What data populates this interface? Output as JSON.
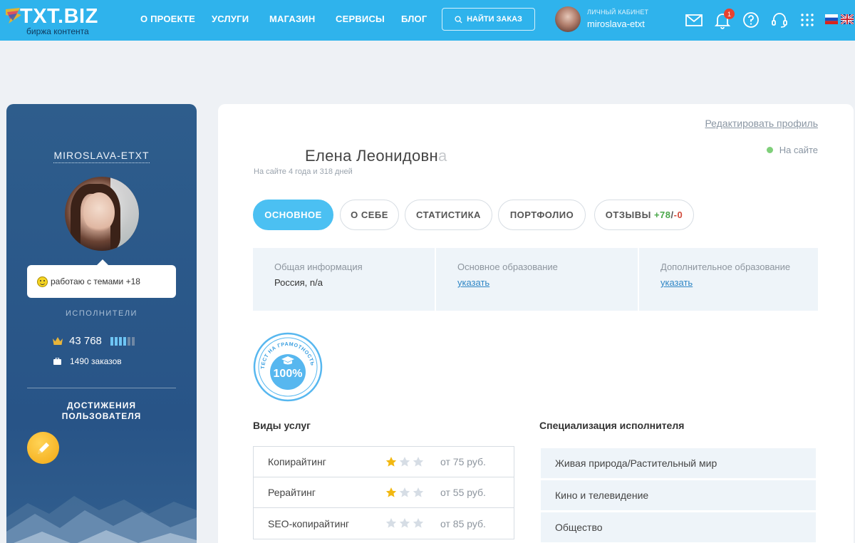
{
  "header": {
    "logo_text": "TXT.BIZ",
    "logo_sub": "биржа контента",
    "nav": [
      "О ПРОЕКТЕ",
      "УСЛУГИ",
      "МАГАЗИН",
      "СЕРВИСЫ",
      "БЛОГ"
    ],
    "search_label": "НАЙТИ ЗАКАЗ",
    "cabinet_caption": "ЛИЧНЫЙ КАБИНЕТ",
    "cabinet_user": "miroslava-etxt",
    "notification_count": "1",
    "icons": [
      "mail-icon",
      "bell-icon",
      "help-icon",
      "headset-icon",
      "apps-grid-icon"
    ],
    "languages": [
      "ru",
      "en"
    ],
    "accent_color": "#2fb3ec"
  },
  "sidebar": {
    "username": "MIROSLAVA-ETXT",
    "tooltip": "работаю с темами +18",
    "section_label": "ИСПОЛНИТЕЛИ",
    "rating": "43 768",
    "rating_level": 0.67,
    "orders": "1490 заказов",
    "achievements_line1": "ДОСТИЖЕНИЯ",
    "achievements_line2": "ПОЛЬЗОВАТЕЛЯ"
  },
  "profile": {
    "edit_link": "Редактировать профиль",
    "status": "На сайте",
    "name": "Елена Леонидовн",
    "name_fade": "а",
    "since": "На сайте 4 года и 318 дней",
    "tabs": {
      "main": "ОСНОВНОЕ",
      "about": "О СЕБЕ",
      "stats": "СТАТИСТИКА",
      "portfolio": "ПОРТФОЛИО",
      "reviews": "ОТЗЫВЫ",
      "reviews_pos": "+78",
      "reviews_sep": "/",
      "reviews_neg": "-0"
    },
    "info": {
      "general_label": "Общая информация",
      "general_value": "Россия, n/a",
      "edu_label": "Основное образование",
      "edu_link": "указать",
      "extra_label": "Дополнительное образование",
      "extra_link": "указать"
    },
    "stamp": {
      "arc_text": "ТЕСТ НА ГРАМОТНОСТЬ",
      "score": "100%"
    },
    "services_title": "Виды услуг",
    "services": [
      {
        "name": "Копирайтинг",
        "stars": 1,
        "price": "от 75 руб."
      },
      {
        "name": "Рерайтинг",
        "stars": 1,
        "price": "от 55 руб."
      },
      {
        "name": "SEO-копирайтинг",
        "stars": 0,
        "price": "от 85 руб."
      }
    ],
    "spec_title": "Специализация исполнителя",
    "specializations": [
      "Живая природа/Растительный мир",
      "Кино и телевидение",
      "Общество"
    ]
  }
}
